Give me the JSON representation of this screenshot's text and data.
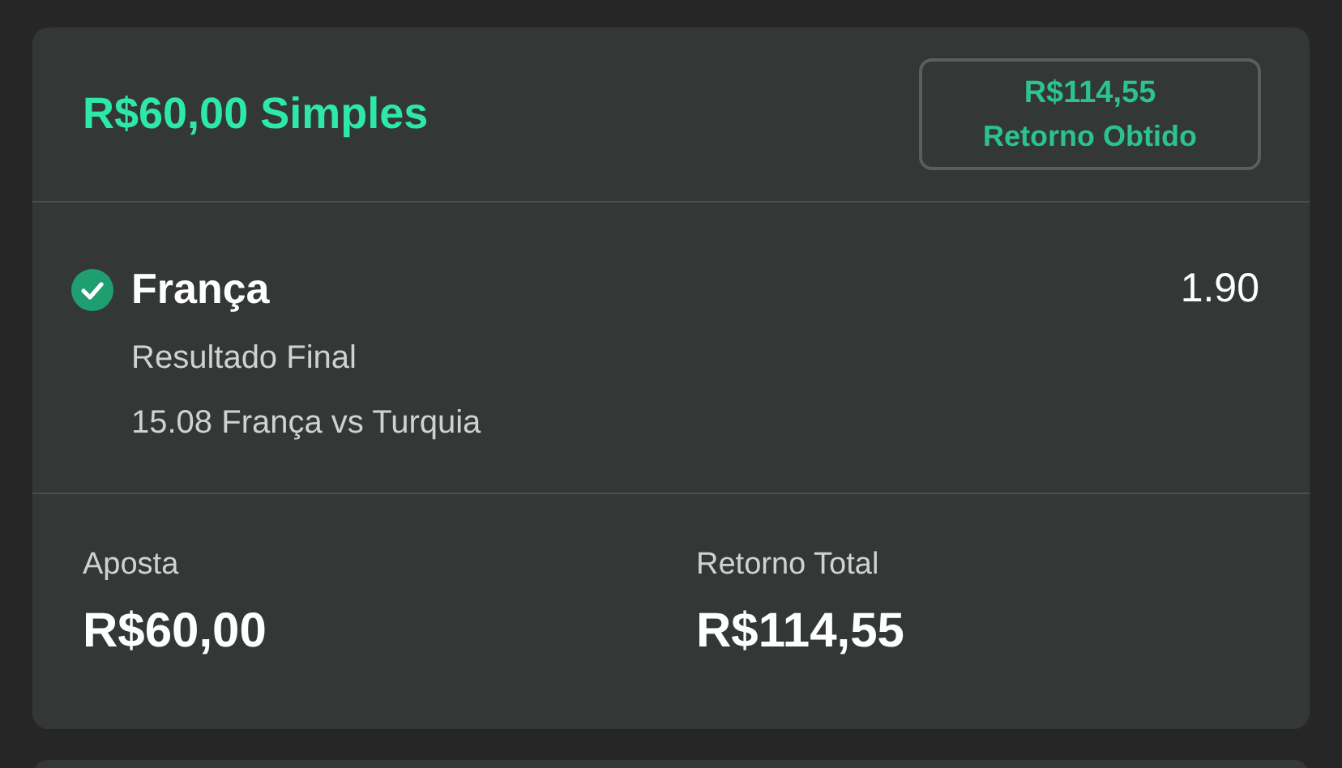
{
  "bet": {
    "title": "R$60,00 Simples",
    "return_badge": {
      "amount": "R$114,55",
      "label": "Retorno Obtido"
    },
    "selection": {
      "won": true,
      "name": "França",
      "odds": "1.90",
      "market": "Resultado Final",
      "event": "15.08 França vs Turquia"
    },
    "summary": [
      {
        "label": "Aposta",
        "value": "R$60,00"
      },
      {
        "label": "Retorno Total",
        "value": "R$114,55"
      }
    ]
  }
}
